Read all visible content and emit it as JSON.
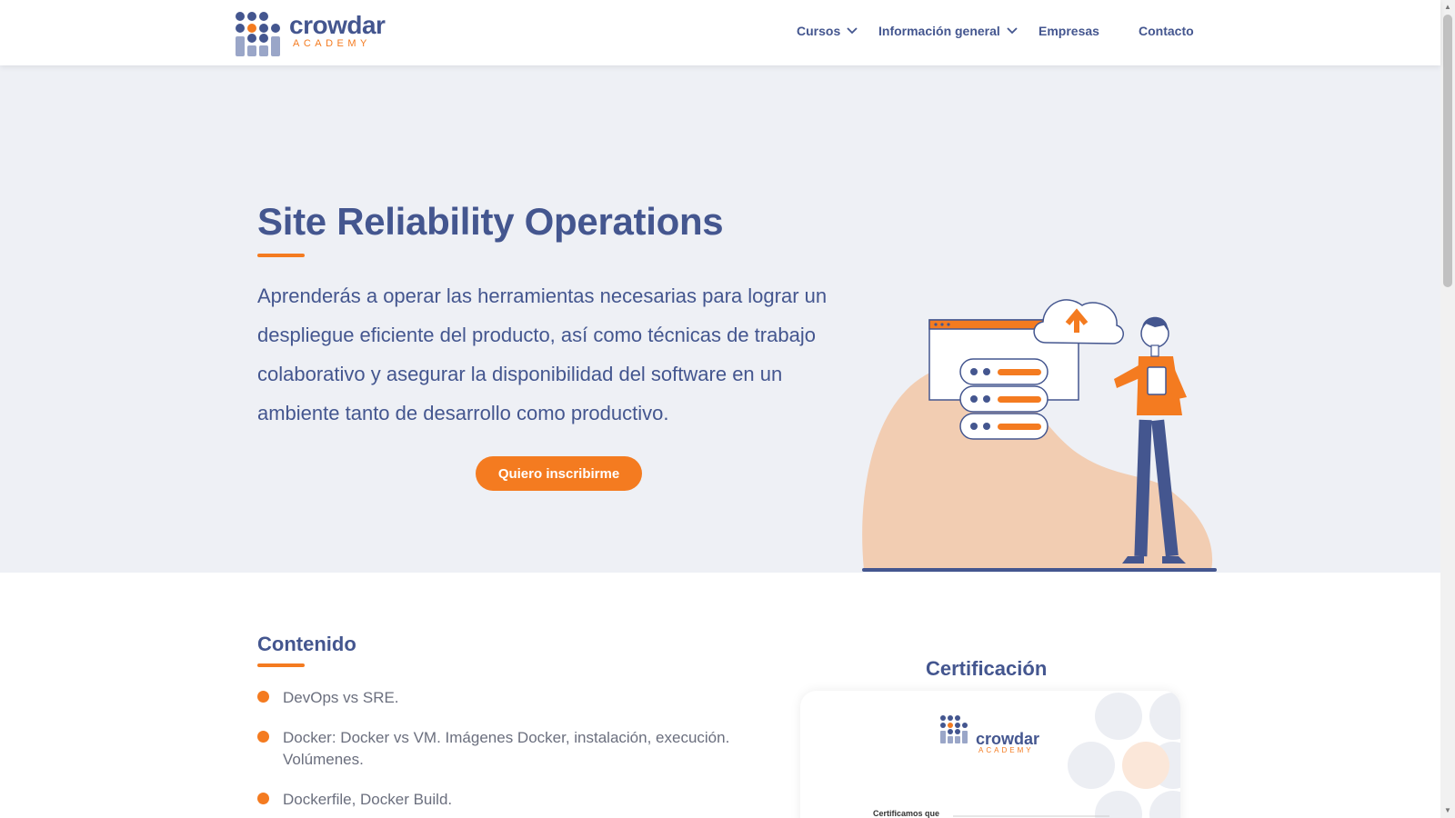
{
  "brand": {
    "name": "crowdar",
    "sub": "ACADEMY",
    "primary": "#44568f",
    "accent": "#f47b20"
  },
  "nav": {
    "cursos": "Cursos",
    "informacion": "Información general",
    "empresas": "Empresas",
    "contacto": "Contacto"
  },
  "hero": {
    "title": "Site Reliability Operations",
    "description": "Aprenderás a operar las herramientas necesarias para lograr un despliegue eficiente del producto, así como técnicas de trabajo colaborativo y asegurar la disponibilidad del software en un ambiente tanto de desarrollo como productivo.",
    "cta": "Quiero inscribirme"
  },
  "contenido": {
    "title": "Contenido",
    "items": [
      "DevOps vs SRE.",
      "Docker: Docker vs VM. Imágenes Docker, instalación, execución. Volúmenes.",
      "Dockerfile, Docker Build."
    ]
  },
  "certificacion": {
    "title": "Certificación",
    "card_brand": "crowdar",
    "card_sub": "ACADEMY",
    "card_text": "Certificamos que"
  }
}
